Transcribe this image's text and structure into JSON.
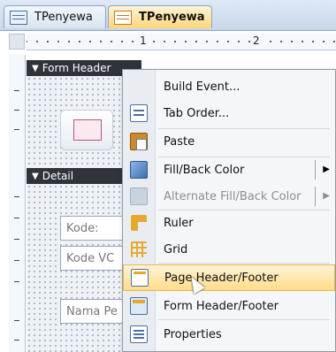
{
  "tabs": [
    {
      "label": "TPenyewa",
      "active": false
    },
    {
      "label": "TPenyewa",
      "active": true
    }
  ],
  "ruler": {
    "marks": [
      "1",
      "2"
    ]
  },
  "sections": {
    "form_header": "Form Header",
    "detail": "Detail"
  },
  "form_fields": [
    {
      "text": "Kode:"
    },
    {
      "text": "Kode VC"
    },
    {
      "text": "Nama Pe"
    }
  ],
  "context_menu": {
    "items": [
      {
        "id": "build-event",
        "label": "Build Event...",
        "icon": "none",
        "enabled": true
      },
      {
        "id": "tab-order",
        "label": "Tab Order...",
        "icon": "tab-order-icon",
        "enabled": true
      },
      {
        "id": "paste",
        "label": "Paste",
        "icon": "paste-icon",
        "enabled": true
      },
      {
        "id": "fill-back-color",
        "label": "Fill/Back Color",
        "icon": "fill-color-icon",
        "enabled": true,
        "submenu": true
      },
      {
        "id": "alt-fill-back-color",
        "label": "Alternate Fill/Back Color",
        "icon": "alternate-fill-color-icon",
        "enabled": false,
        "submenu": true
      },
      {
        "id": "ruler",
        "label": "Ruler",
        "icon": "ruler-icon",
        "enabled": true
      },
      {
        "id": "grid",
        "label": "Grid",
        "icon": "grid-icon",
        "enabled": true
      },
      {
        "id": "page-header-footer",
        "label": "Page Header/Footer",
        "icon": "page-header-footer-icon",
        "enabled": true,
        "highlighted": true
      },
      {
        "id": "form-header-footer",
        "label": "Form Header/Footer",
        "icon": "form-header-footer-icon",
        "enabled": true
      },
      {
        "id": "properties",
        "label": "Properties",
        "icon": "properties-icon",
        "enabled": true
      }
    ]
  },
  "colors": {
    "section_bar": "#30333a",
    "menu_highlight": "#ffdd8a",
    "active_tab": "#ffd57a"
  }
}
